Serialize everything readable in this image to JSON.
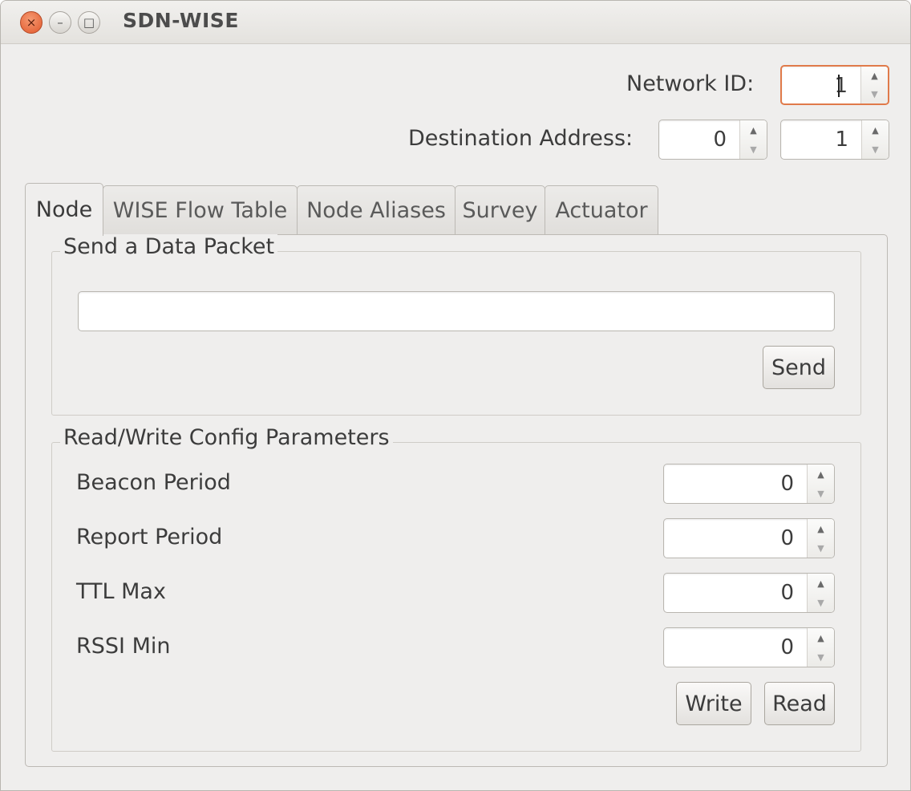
{
  "window": {
    "title": "SDN-WISE",
    "buttons": {
      "close": "×",
      "minimize": "–",
      "maximize": "□"
    }
  },
  "header": {
    "network_id": {
      "label": "Network ID:",
      "value": "1"
    },
    "destination": {
      "label": "Destination Address:",
      "value_high": "0",
      "value_low": "1"
    }
  },
  "tabs": [
    {
      "label": "Node",
      "active": true
    },
    {
      "label": "WISE Flow Table",
      "active": false
    },
    {
      "label": "Node Aliases",
      "active": false
    },
    {
      "label": "Survey",
      "active": false
    },
    {
      "label": "Actuator",
      "active": false
    }
  ],
  "send_packet": {
    "title": "Send a Data Packet",
    "input_value": "",
    "send_label": "Send"
  },
  "config": {
    "title": "Read/Write Config Parameters",
    "params": [
      {
        "label": "Beacon Period",
        "value": "0"
      },
      {
        "label": "Report Period",
        "value": "0"
      },
      {
        "label": "TTL Max",
        "value": "0"
      },
      {
        "label": "RSSI Min",
        "value": "0"
      }
    ],
    "write_label": "Write",
    "read_label": "Read"
  },
  "icons": {
    "spin_up": "▲",
    "spin_down": "▼"
  },
  "colors": {
    "focus": "#e07a4a",
    "close_button": "#e1582c"
  }
}
